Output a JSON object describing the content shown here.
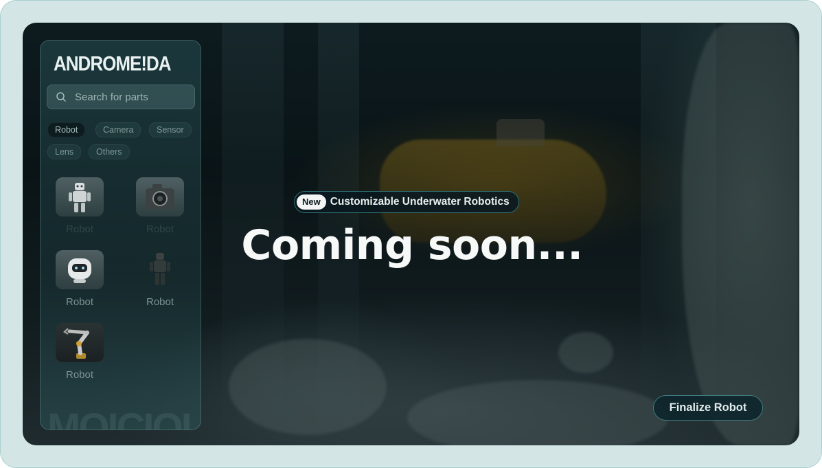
{
  "brand": {
    "logo_text": "ANDROME!DA",
    "watermark_text": "MOICIOI"
  },
  "search": {
    "placeholder": "Search for parts"
  },
  "filters": [
    {
      "label": "Robot",
      "active": true
    },
    {
      "label": "Camera",
      "active": false
    },
    {
      "label": "Sensor",
      "active": false
    },
    {
      "label": "Lens",
      "active": false
    },
    {
      "label": "Others",
      "active": false
    }
  ],
  "parts": [
    {
      "label": "Robot",
      "icon": "humanoid-robot-icon"
    },
    {
      "label": "Robot",
      "icon": "camera-robot-icon"
    },
    {
      "label": "Robot",
      "icon": "round-robot-icon"
    },
    {
      "label": "Robot",
      "icon": "dark-humanoid-robot-icon"
    },
    {
      "label": "Robot",
      "icon": "robotic-arm-icon"
    }
  ],
  "hero": {
    "badge_new": "New",
    "badge_text": "Customizable Underwater Robotics",
    "headline": "Coming soon..."
  },
  "actions": {
    "finalize_label": "Finalize Robot"
  },
  "colors": {
    "background": "#d3e6e5",
    "accent_border": "#2f6e72",
    "headline": "#f7f8f8"
  }
}
